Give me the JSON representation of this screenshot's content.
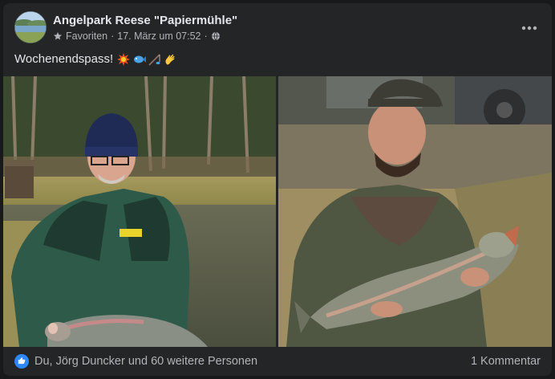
{
  "post": {
    "page_name": "Angelpark Reese \"Papiermühle\"",
    "audience": "Favoriten",
    "separator": "·",
    "date": "17. März um 07:52",
    "text": "Wochenendspass!",
    "emojis": [
      "collision-emoji",
      "fish-emoji",
      "fishing-rod-emoji",
      "waving-hand-emoji"
    ]
  },
  "footer": {
    "reactions_text": "Du, Jörg Duncker und 60 weitere Personen",
    "comments_text": "1 Kommentar"
  },
  "colors": {
    "card_bg": "#242526",
    "primary_text": "#e4e6eb",
    "secondary_text": "#b0b3b8",
    "like_blue": "#2d88ff"
  },
  "icons": {
    "audience": "star-icon",
    "privacy": "globe-icon",
    "more": "more-options-icon",
    "reaction": "like-icon"
  }
}
